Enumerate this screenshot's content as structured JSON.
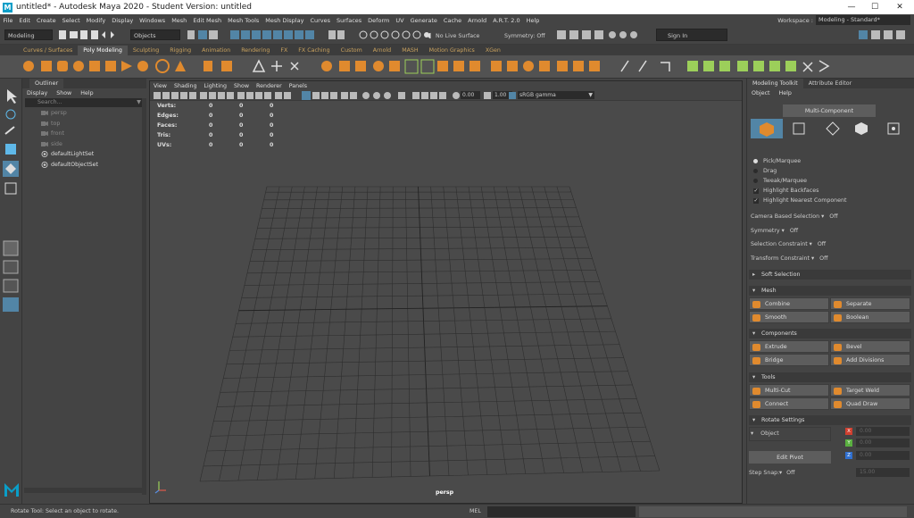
{
  "window": {
    "title": "untitled* - Autodesk Maya 2020 - Student Version: untitled",
    "min": "—",
    "max": "☐",
    "close": "✕"
  },
  "menus": [
    "File",
    "Edit",
    "Create",
    "Select",
    "Modify",
    "Display",
    "Windows",
    "Mesh",
    "Edit Mesh",
    "Mesh Tools",
    "Mesh Display",
    "Curves",
    "Surfaces",
    "Deform",
    "UV",
    "Generate",
    "Cache",
    "Arnold",
    "A.R.T. 2.0",
    "Help"
  ],
  "workspace": {
    "label": "Workspace :",
    "value": "Modeling - Standard*"
  },
  "statusline": {
    "menuset": "Modeling",
    "selmask": "Objects",
    "live": "No Live Surface",
    "symmetry": "Symmetry: Off",
    "signin": "Sign In"
  },
  "shelf_tabs": [
    "Curves / Surfaces",
    "Poly Modeling",
    "Sculpting",
    "Rigging",
    "Animation",
    "Rendering",
    "FX",
    "FX Caching",
    "Custom",
    "Arnold",
    "MASH",
    "Motion Graphics",
    "XGen"
  ],
  "shelf_active": 1,
  "outliner": {
    "tab": "Outliner",
    "menu": [
      "Display",
      "Show",
      "Help"
    ],
    "search_placeholder": "Search...",
    "items": [
      "persp",
      "top",
      "front",
      "side",
      "defaultLightSet",
      "defaultObjectSet"
    ]
  },
  "viewport": {
    "menu": [
      "View",
      "Shading",
      "Lighting",
      "Show",
      "Renderer",
      "Panels"
    ],
    "hud": [
      {
        "label": "Verts:",
        "a": "0",
        "b": "0",
        "c": "0"
      },
      {
        "label": "Edges:",
        "a": "0",
        "b": "0",
        "c": "0"
      },
      {
        "label": "Faces:",
        "a": "0",
        "b": "0",
        "c": "0"
      },
      {
        "label": "Tris:",
        "a": "0",
        "b": "0",
        "c": "0"
      },
      {
        "label": "UVs:",
        "a": "0",
        "b": "0",
        "c": "0"
      }
    ],
    "exposure": "0.00",
    "gamma": "1.00",
    "colorspace": "sRGB gamma",
    "camera": "persp"
  },
  "modeling": {
    "tabs": [
      "Modeling Toolkit",
      "Attribute Editor"
    ],
    "menu": [
      "Object",
      "Help"
    ],
    "mode_button": "Multi-Component",
    "pick": [
      "Pick/Marquee",
      "Drag",
      "Tweak/Marquee"
    ],
    "checks": [
      "Highlight Backfaces",
      "Highlight Nearest Component"
    ],
    "props": [
      {
        "label": "Camera Based Selection",
        "value": "Off"
      },
      {
        "label": "Symmetry",
        "value": "Off"
      },
      {
        "label": "Selection Constraint",
        "value": "Off"
      },
      {
        "label": "Transform Constraint",
        "value": "Off"
      }
    ],
    "soft_selection": "Soft Selection",
    "sections": {
      "mesh": {
        "title": "Mesh",
        "buttons": [
          "Combine",
          "Separate",
          "Smooth",
          "Boolean"
        ]
      },
      "components": {
        "title": "Components",
        "buttons": [
          "Extrude",
          "Bevel",
          "Bridge",
          "Add Divisions"
        ]
      },
      "tools": {
        "title": "Tools",
        "buttons": [
          "Multi-Cut",
          "Target Weld",
          "Connect",
          "Quad Draw"
        ]
      }
    },
    "rotate": {
      "title": "Rotate Settings",
      "object": "Object",
      "edit_pivot": "Edit Pivot",
      "x": "0.00",
      "y": "0.00",
      "z": "0.00"
    },
    "step_snap": {
      "label": "Step Snap:",
      "value": "Off",
      "amount": "15.00"
    }
  },
  "status": {
    "help": "Rotate Tool: Select an object to rotate.",
    "mel": "MEL"
  },
  "colors": {
    "accent": "#e08a2e",
    "select": "#5285a6",
    "grid": "#2e2e2e"
  }
}
